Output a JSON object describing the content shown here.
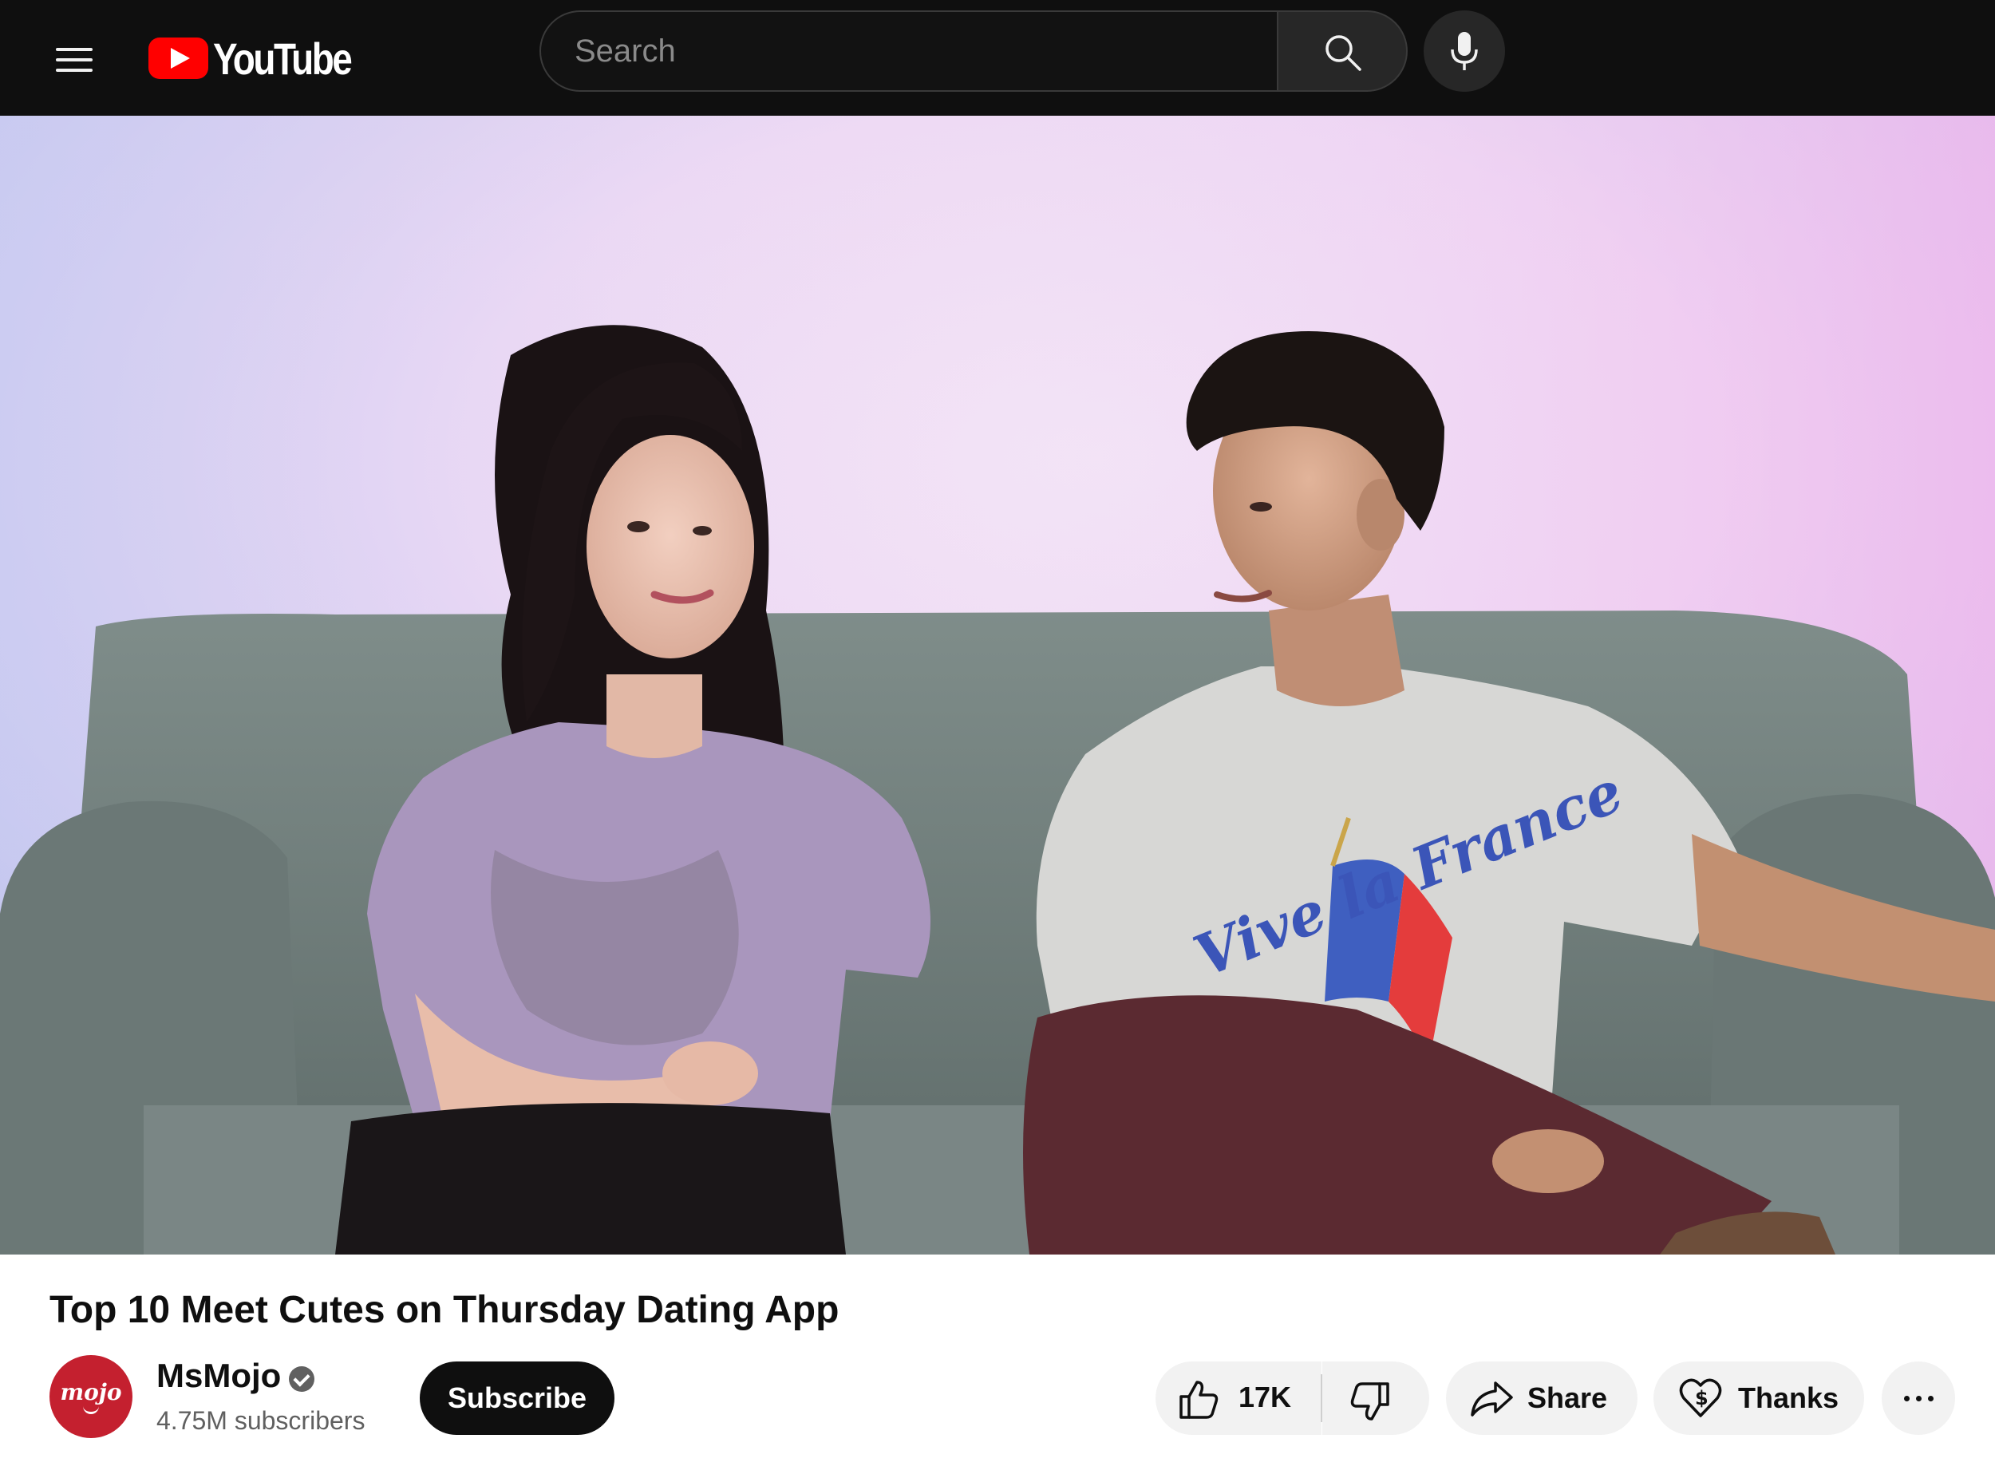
{
  "header": {
    "logo_text": "YouTube",
    "search_placeholder": "Search",
    "icons": [
      "menu-icon",
      "youtube-logo-icon",
      "search-icon",
      "mic-icon"
    ]
  },
  "video": {
    "title": "Top 10 Meet Cutes on Thursday Dating App",
    "shirt_text": "Vive la France"
  },
  "channel": {
    "name": "MsMojo",
    "verified": true,
    "subscribers": "4.75M subscribers",
    "avatar_text": "mojo",
    "subscribe_label": "Subscribe"
  },
  "actions": {
    "like_count": "17K",
    "share_label": "Share",
    "thanks_label": "Thanks",
    "icons": [
      "thumbs-up-icon",
      "thumbs-down-icon",
      "share-arrow-icon",
      "heart-dollar-icon",
      "more-dots-icon"
    ]
  },
  "colors": {
    "topbar_bg": "#0f0f0f",
    "logo_red": "#ff0000",
    "avatar_red": "#c4202f",
    "pill_bg": "#f2f2f2",
    "subscribe_bg": "#0f0f0f"
  }
}
